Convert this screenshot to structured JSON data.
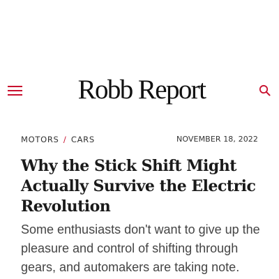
{
  "header": {
    "logo_text": "Robb Report",
    "menu_icon": "hamburger-menu-icon",
    "search_icon": "search-icon",
    "accent_color": "#c8102e"
  },
  "article": {
    "breadcrumb": {
      "section": "MOTORS",
      "separator": "/",
      "subsection": "CARS"
    },
    "date": "NOVEMBER 18, 2022",
    "headline": "Why the Stick Shift Might Actually Survive the Electric Revolution",
    "dek": "Some enthusiasts don't want to give up the pleasure and control of shifting through gears, and automakers are taking note."
  }
}
